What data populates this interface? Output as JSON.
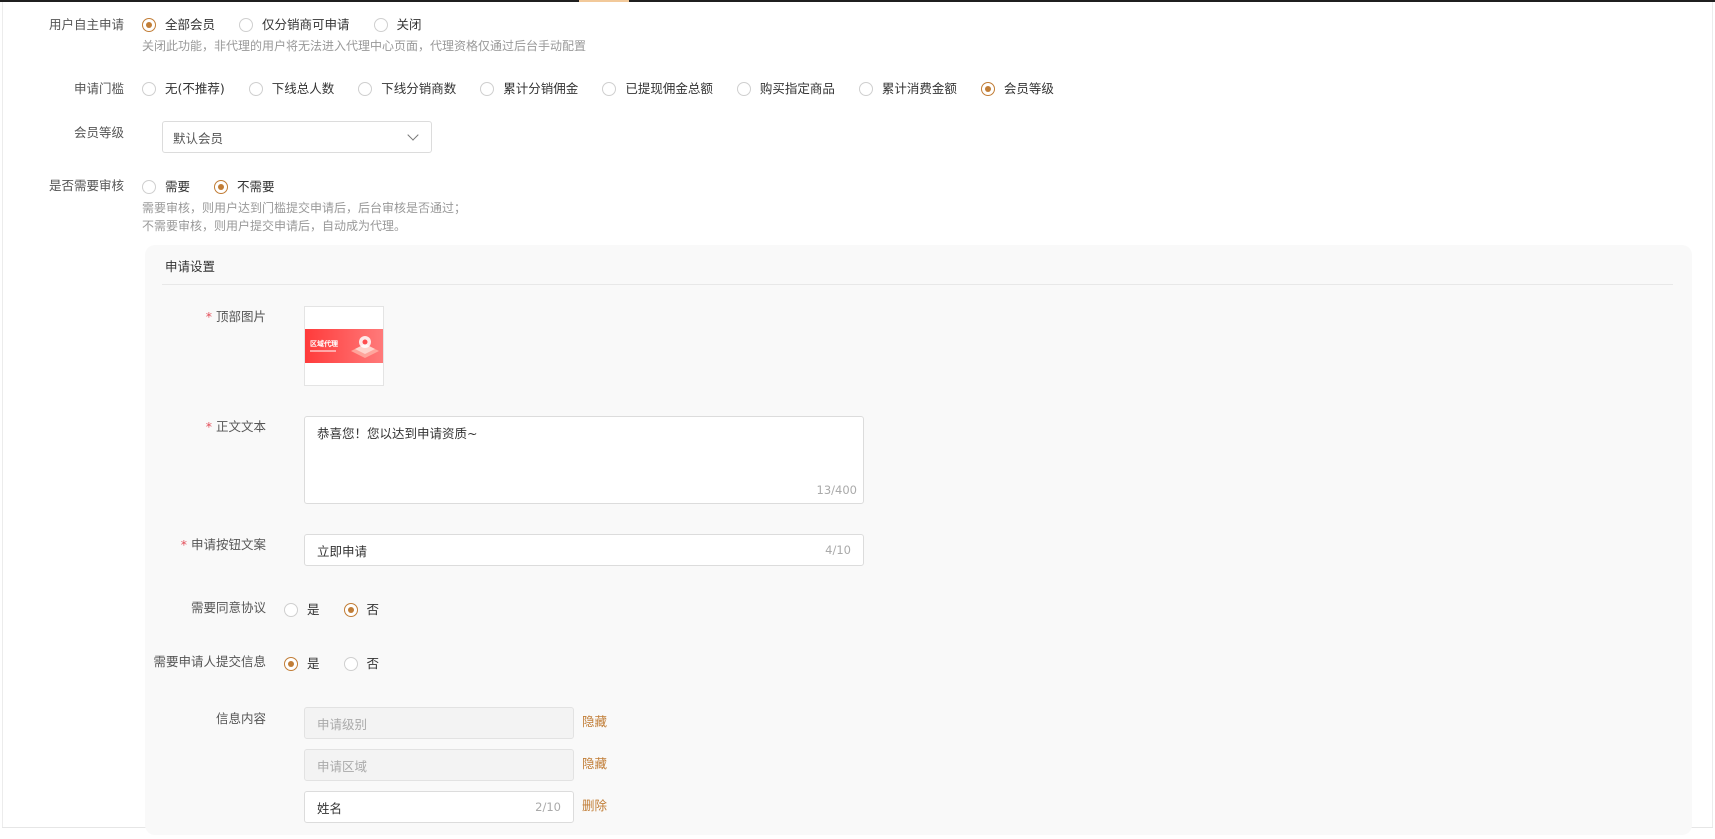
{
  "user_apply": {
    "label": "用户自主申请",
    "options": [
      "全部会员",
      "仅分销商可申请",
      "关闭"
    ],
    "selected": 0,
    "hint": "关闭此功能，非代理的用户将无法进入代理中心页面，代理资格仅通过后台手动配置"
  },
  "threshold": {
    "label": "申请门槛",
    "options": [
      "无(不推荐)",
      "下线总人数",
      "下线分销商数",
      "累计分销佣金",
      "已提现佣金总额",
      "购买指定商品",
      "累计消费金额",
      "会员等级"
    ],
    "selected": 7
  },
  "member_level": {
    "label": "会员等级",
    "value": "默认会员"
  },
  "review": {
    "label": "是否需要审核",
    "options": [
      "需要",
      "不需要"
    ],
    "selected": 1,
    "hint1": "需要审核，则用户达到门槛提交申请后，后台审核是否通过；",
    "hint2": "不需要审核，则用户提交申请后，自动成为代理。"
  },
  "apply_settings": {
    "title": "申请设置",
    "top_image": {
      "label": "顶部图片",
      "banner_text": "区域代理"
    },
    "body_text": {
      "label": "正文文本",
      "value": "恭喜您！您以达到申请资质~",
      "count": "13/400"
    },
    "button_text": {
      "label": "申请按钮文案",
      "value": "立即申请",
      "count": "4/10"
    },
    "agreement": {
      "label": "需要同意协议",
      "options": [
        "是",
        "否"
      ],
      "selected": 1
    },
    "submit_info": {
      "label": "需要申请人提交信息",
      "options": [
        "是",
        "否"
      ],
      "selected": 0
    },
    "info_content": {
      "label": "信息内容",
      "fields": [
        {
          "value": "申请级别",
          "action": "隐藏",
          "count": ""
        },
        {
          "value": "申请区域",
          "action": "隐藏",
          "count": ""
        },
        {
          "value": "姓名",
          "action": "删除",
          "count": "2/10"
        }
      ]
    }
  },
  "colors": {
    "accent": "#c17d36",
    "required": "#e34d59",
    "banner_red": "#ff4d4f"
  }
}
